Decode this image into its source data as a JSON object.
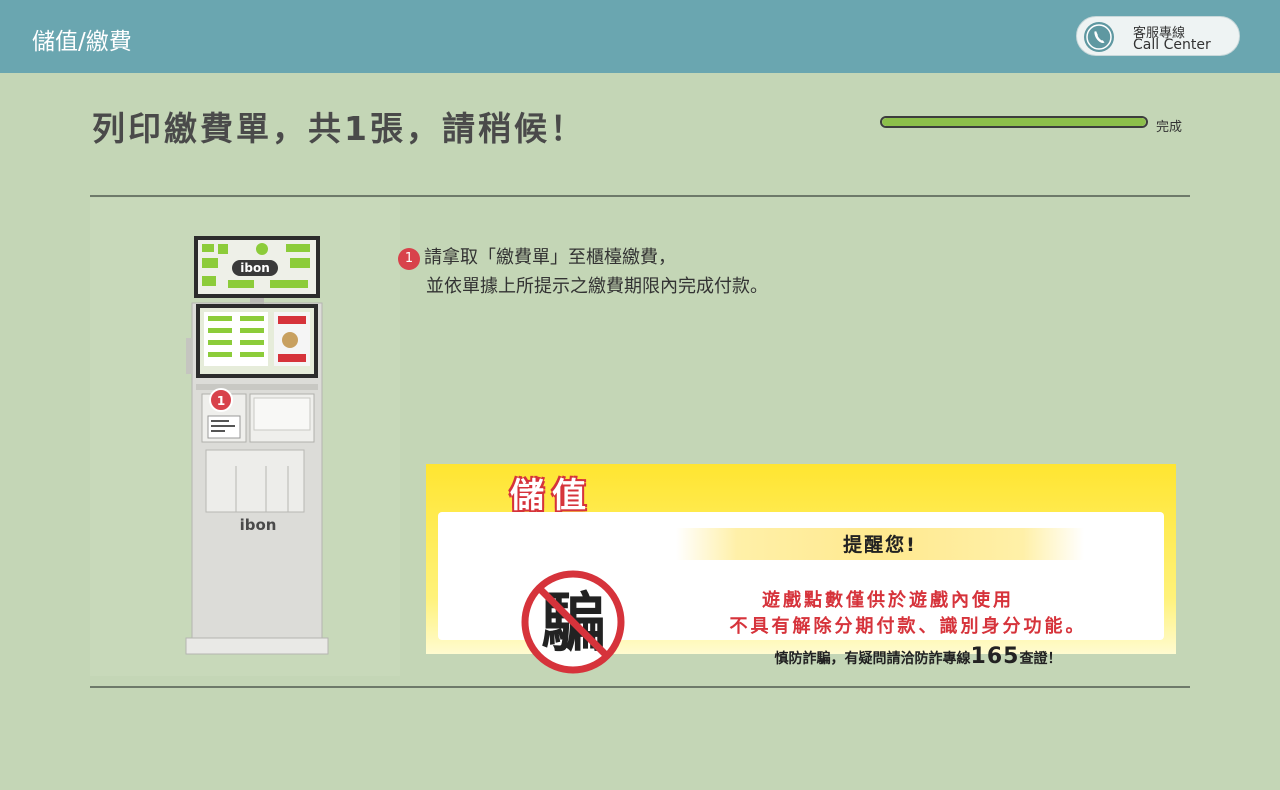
{
  "header": {
    "breadcrumb": "儲值/繳費",
    "call_center": {
      "line1": "客服專線",
      "line2": "Call Center",
      "icon": "phone-icon"
    }
  },
  "main": {
    "title": "列印繳費單，共1張，請稍候！",
    "progress": {
      "value": 1.0,
      "label": "完成",
      "fill_color": "#8cbf4a"
    }
  },
  "kiosk": {
    "brand": "ibon",
    "step_marker": "1"
  },
  "instructions": {
    "step_number": "1",
    "line1": "請拿取「繳費單」至櫃檯繳費，",
    "line2": "並依單據上所提示之繳費期限內完成付款。"
  },
  "notice": {
    "tag": "儲值",
    "heading": "提醒您!",
    "warning_line1": "遊戲點數僅供於遊戲內使用",
    "warning_line2": "不具有解除分期付款、識別身分功能。",
    "hotline_prefix": "慎防詐騙，有疑問請洽防詐專線",
    "hotline_number": "165",
    "hotline_suffix": "查證！",
    "sign_text": "騙",
    "accent_color": "#d6333b",
    "background_color": "#ffe531"
  }
}
